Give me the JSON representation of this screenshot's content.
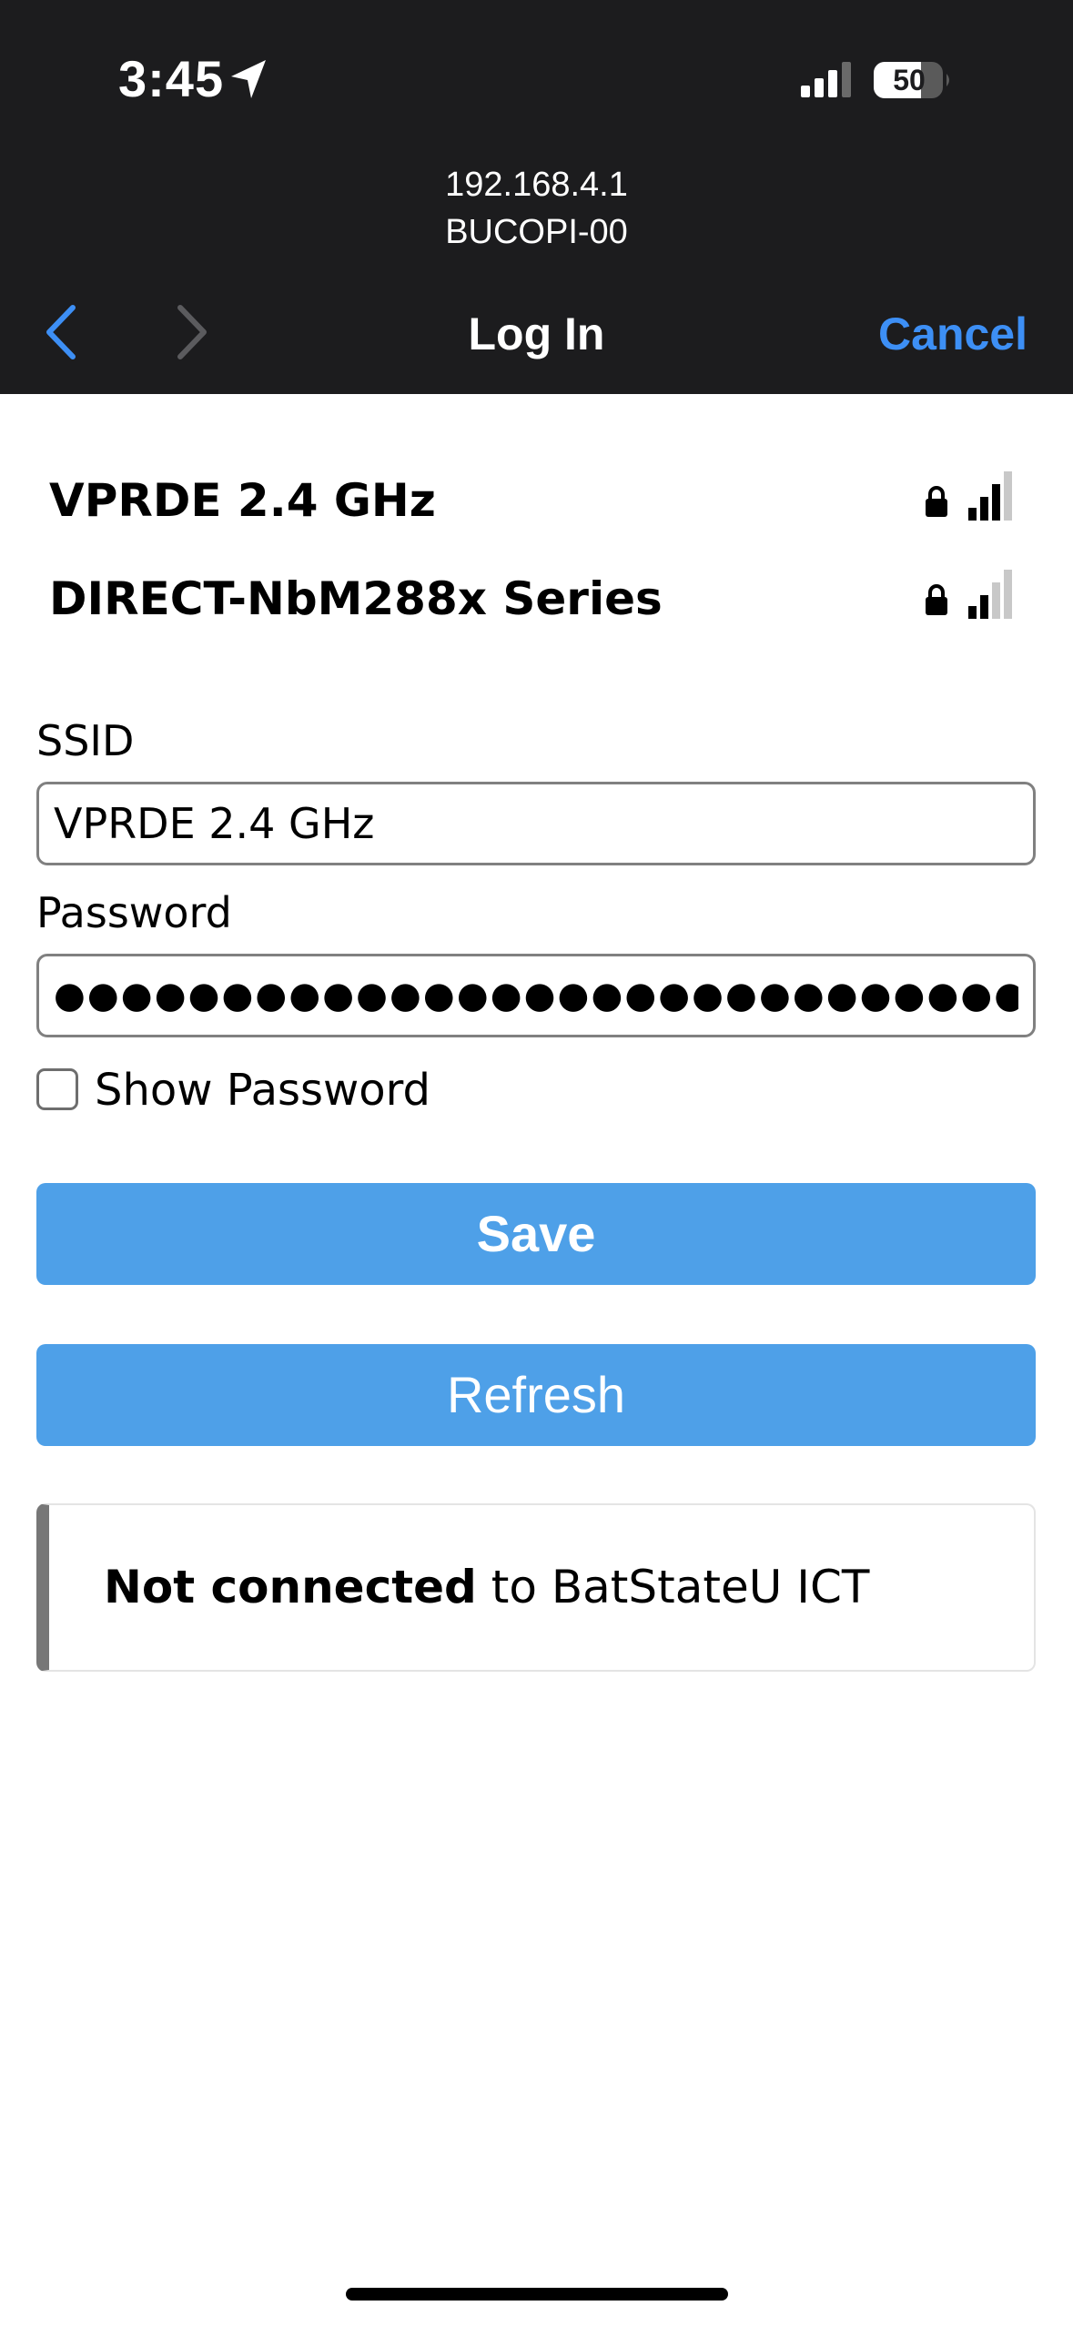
{
  "status_bar": {
    "time": "3:45",
    "battery": "50",
    "icons": [
      "location-icon",
      "cellular-signal-icon",
      "battery-icon"
    ]
  },
  "browser": {
    "url": "192.168.4.1",
    "page_subtitle": "BUCOPI-00",
    "title": "Log In",
    "cancel_label": "Cancel",
    "accent_color": "#3d8ff5"
  },
  "networks": [
    {
      "name": "VPRDE 2.4 GHz",
      "secured": true,
      "signal_bars": 3,
      "signal_of": 4
    },
    {
      "name": "DIRECT-NbM288x Series",
      "secured": true,
      "signal_bars": 2,
      "signal_of": 4
    }
  ],
  "form": {
    "ssid_label": "SSID",
    "ssid_value": "VPRDE 2.4 GHz",
    "password_label": "Password",
    "password_value": "●●●●●●●●●●●●●●●●●●●●●●●●●●●●●●●●●●●●●●●●●●●●●●",
    "show_password_label": "Show Password",
    "show_password_checked": false,
    "save_label": "Save",
    "refresh_label": "Refresh",
    "button_color": "#4ea0e8"
  },
  "connection_status": {
    "state": "Not connected",
    "detail": "to BatStateU ICT"
  }
}
